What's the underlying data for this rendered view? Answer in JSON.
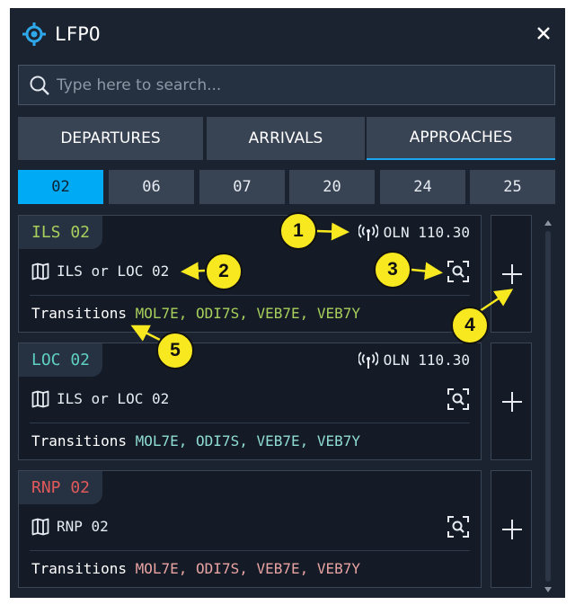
{
  "header": {
    "title": "LFPO",
    "logo_icon": "crosshair-target-icon",
    "close_icon": "close-icon"
  },
  "search": {
    "placeholder": "Type here to search...",
    "value": ""
  },
  "tabs": [
    {
      "label": "DEPARTURES",
      "active": false
    },
    {
      "label": "ARRIVALS",
      "active": false
    },
    {
      "label": "APPROACHES",
      "active": true
    }
  ],
  "runways": [
    {
      "label": "02",
      "active": true
    },
    {
      "label": "06",
      "active": false
    },
    {
      "label": "07",
      "active": false
    },
    {
      "label": "20",
      "active": false
    },
    {
      "label": "24",
      "active": false
    },
    {
      "label": "25",
      "active": false
    }
  ],
  "approaches": [
    {
      "name": "ILS 02",
      "color": "#a8cf5c",
      "frequency": "OLN 110.30",
      "procedure": "ILS or LOC 02",
      "transitions_label": "Transitions",
      "transitions": "MOL7E, ODI7S, VEB7E, VEB7Y"
    },
    {
      "name": "LOC 02",
      "color": "#5fd1c2",
      "frequency": "OLN 110.30",
      "procedure": "ILS or LOC 02",
      "transitions_label": "Transitions",
      "transitions": "MOL7E, ODI7S, VEB7E, VEB7Y"
    },
    {
      "name": "RNP 02",
      "color": "#e05a5a",
      "frequency": "",
      "procedure": "RNP 02",
      "transitions_label": "Transitions",
      "transitions": "MOL7E, ODI7S, VEB7E, VEB7Y",
      "transitions_color": "#e9a3a3"
    }
  ],
  "callouts": [
    "1",
    "2",
    "3",
    "4",
    "5"
  ],
  "colors": {
    "panel": "#1b2330",
    "accent": "#00aaf5",
    "callout": "#f7e81f"
  },
  "icons": {
    "frequency": "radio-antenna-icon",
    "procedure": "map-icon",
    "preview": "zoom-preview-icon",
    "add": "plus-icon"
  }
}
